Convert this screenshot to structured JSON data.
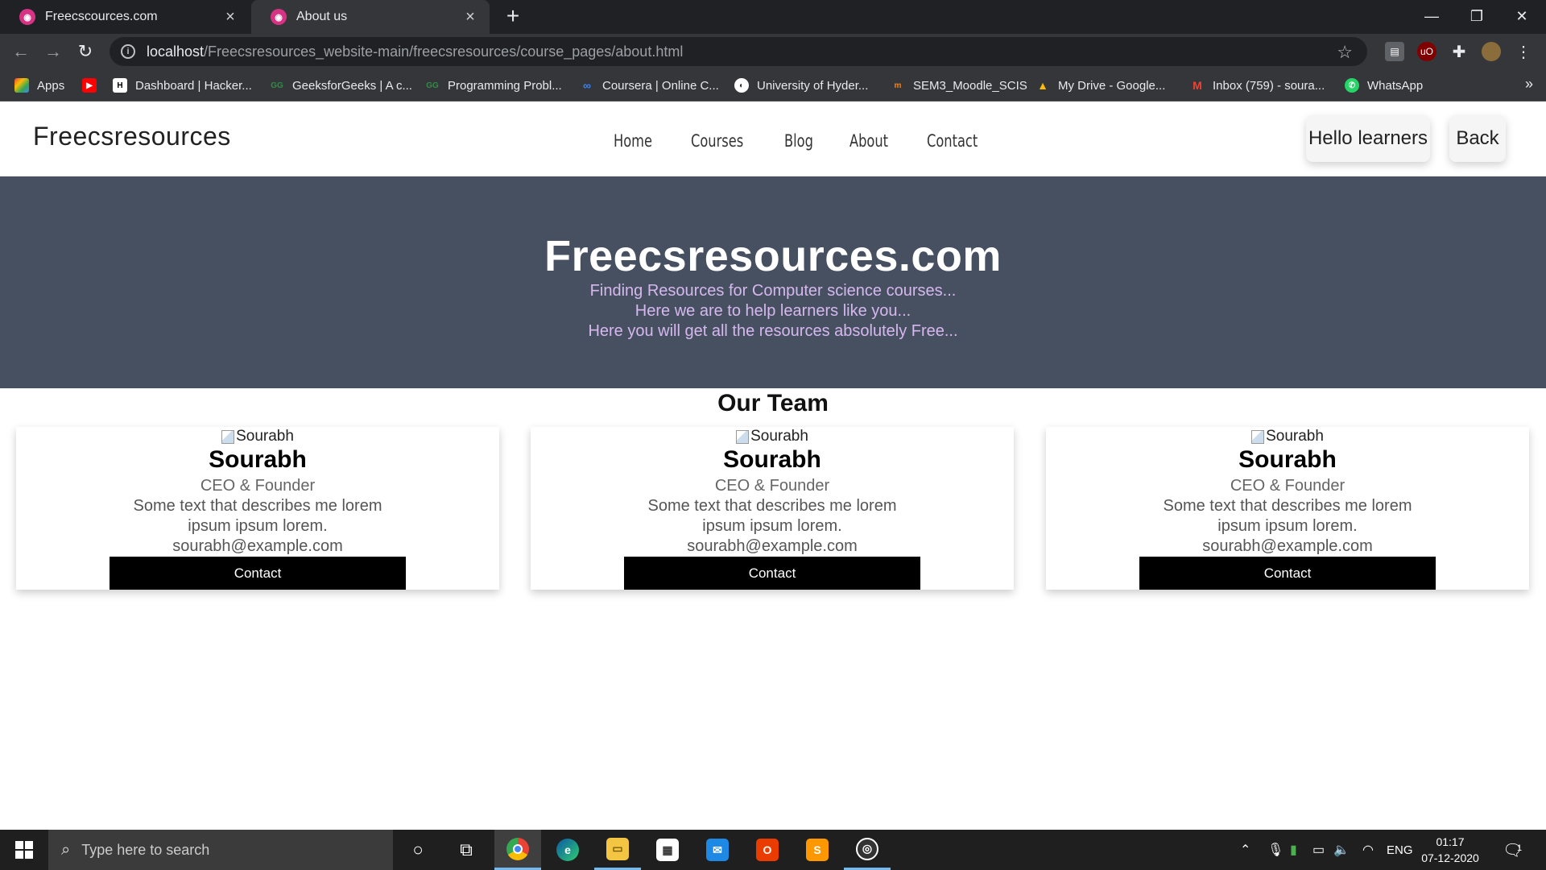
{
  "browser": {
    "tabs": [
      {
        "title": "Freecscources.com",
        "active": false
      },
      {
        "title": "About us",
        "active": true
      }
    ],
    "url_host": "localhost",
    "url_path": "/Freecsresources_website-main/freecsresources/course_pages/about.html",
    "bookmarks": [
      {
        "label": "Apps",
        "icon": "apps-grid-icon"
      },
      {
        "label": "",
        "icon": "youtube-icon"
      },
      {
        "label": "Dashboard | Hacker...",
        "icon": "hackerrank-icon"
      },
      {
        "label": "GeeksforGeeks | A c...",
        "icon": "geeksforgeeks-icon"
      },
      {
        "label": "Programming Probl...",
        "icon": "geeksforgeeks-icon"
      },
      {
        "label": "Coursera | Online C...",
        "icon": "coursera-icon"
      },
      {
        "label": "University of Hyder...",
        "icon": "globe-icon"
      },
      {
        "label": "SEM3_Moodle_SCIS",
        "icon": "moodle-icon"
      },
      {
        "label": "My Drive - Google...",
        "icon": "google-drive-icon"
      },
      {
        "label": "Inbox (759) - soura...",
        "icon": "gmail-icon"
      },
      {
        "label": "WhatsApp",
        "icon": "whatsapp-icon"
      }
    ],
    "bookmarks_more": "»"
  },
  "site": {
    "brand": "Freecsresources",
    "nav": [
      "Home",
      "Courses",
      "Blog",
      "About",
      "Contact"
    ],
    "hello_button": "Hello learners",
    "back_button": "Back"
  },
  "hero": {
    "title": "Freecsresources.com",
    "lines": [
      "Finding Resources for Computer science courses...",
      "Here we are to help learners like you...",
      "Here you will get all the resources absolutely Free..."
    ]
  },
  "team": {
    "heading": "Our Team",
    "members": [
      {
        "img_alt": "Sourabh",
        "name": "Sourabh",
        "role": "CEO & Founder",
        "desc": "Some text that describes me lorem ipsum ipsum lorem.",
        "email": "sourabh@example.com",
        "button": "Contact"
      },
      {
        "img_alt": "Sourabh",
        "name": "Sourabh",
        "role": "CEO & Founder",
        "desc": "Some text that describes me lorem ipsum ipsum lorem.",
        "email": "sourabh@example.com",
        "button": "Contact"
      },
      {
        "img_alt": "Sourabh",
        "name": "Sourabh",
        "role": "CEO & Founder",
        "desc": "Some text that describes me lorem ipsum ipsum lorem.",
        "email": "sourabh@example.com",
        "button": "Contact"
      }
    ]
  },
  "taskbar": {
    "search_placeholder": "Type here to search",
    "lang": "ENG",
    "time": "01:17",
    "date": "07-12-2020",
    "notification_count": "1"
  },
  "colors": {
    "hero_bg": "#465061",
    "hero_subtitle": "#d6b8ee",
    "chrome_dark": "#202124",
    "chrome_toolbar": "#35363a"
  }
}
